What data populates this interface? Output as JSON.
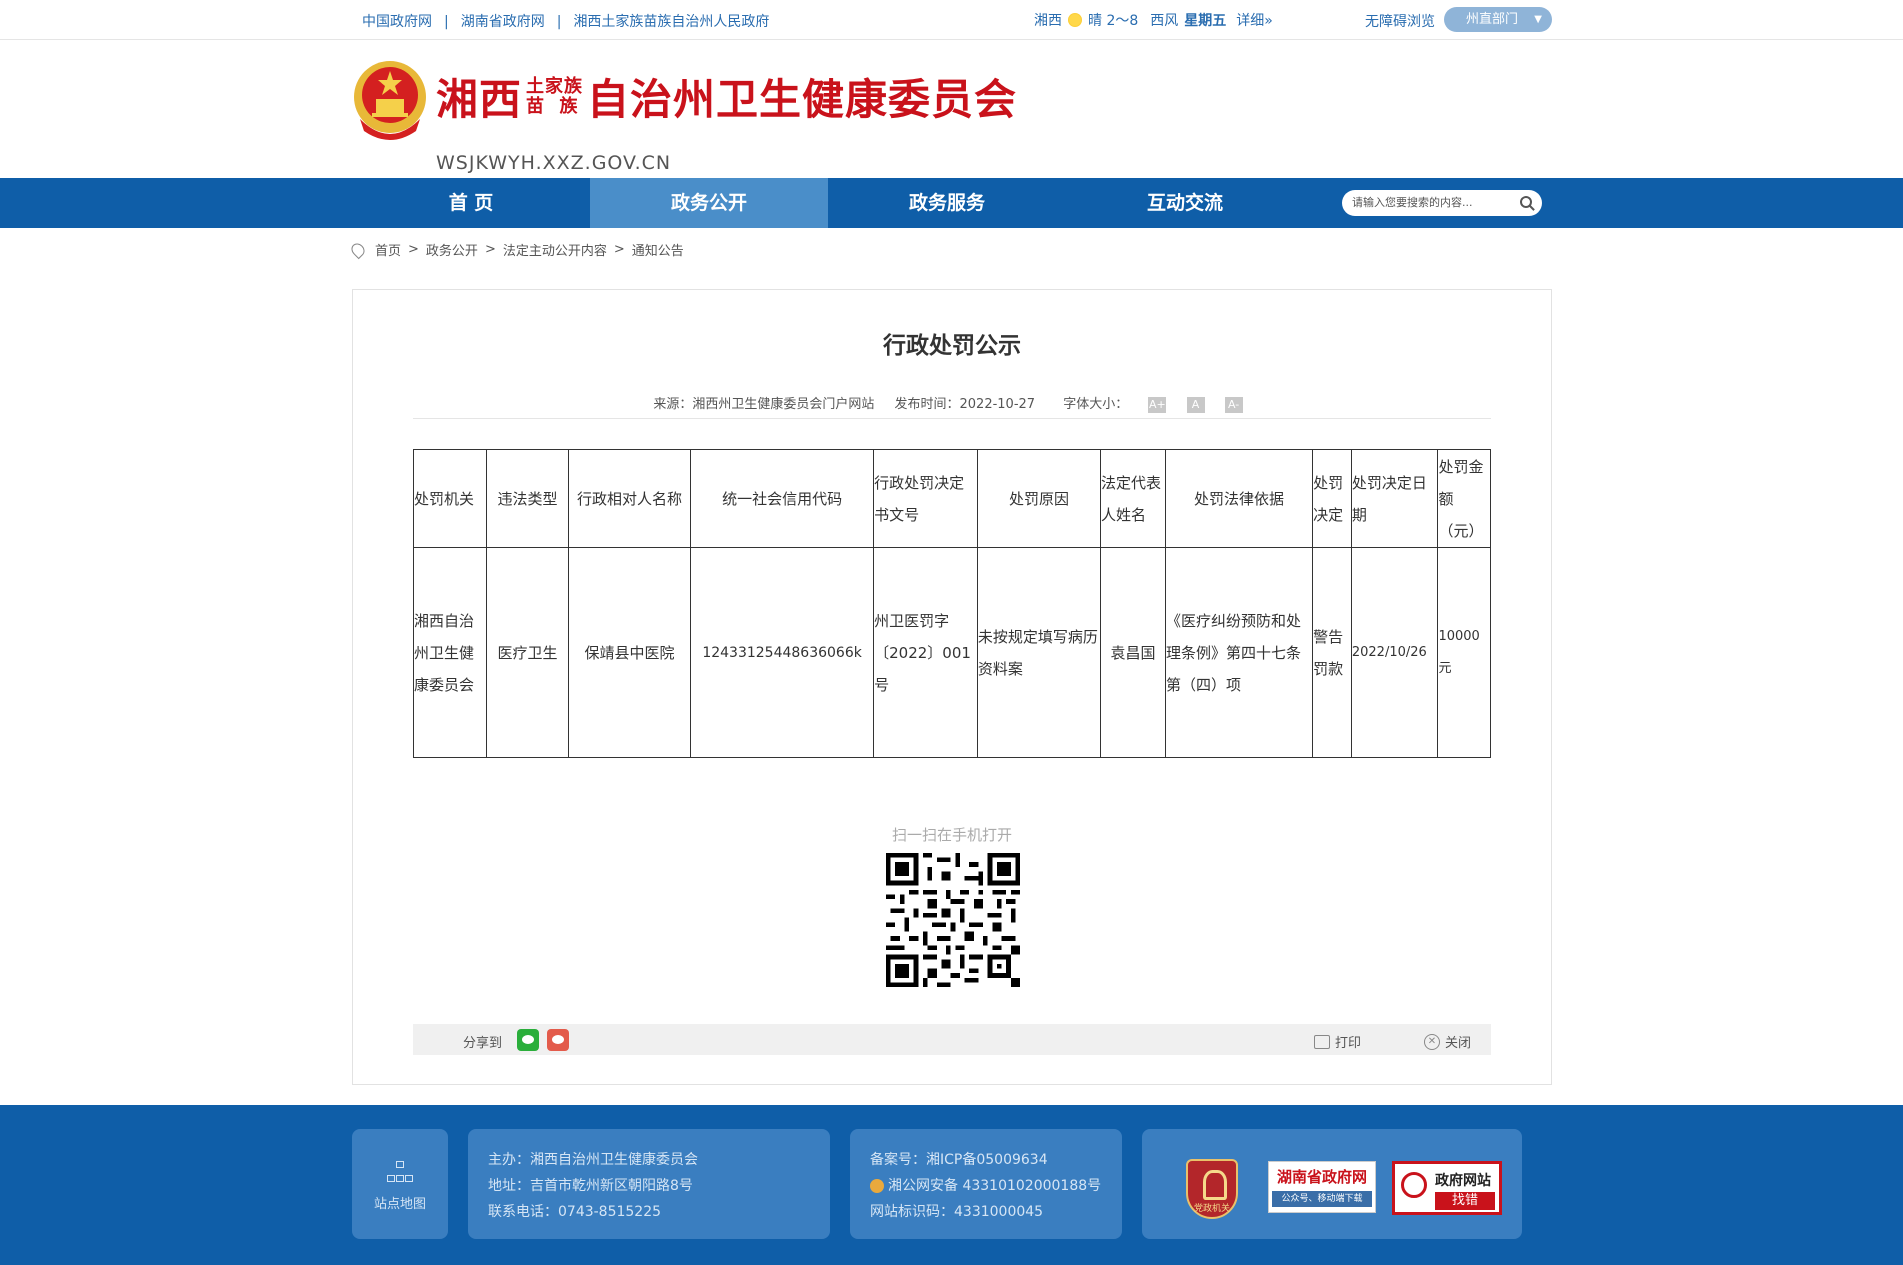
{
  "topbar": {
    "links": [
      "中国政府网",
      "湖南省政府网",
      "湘西土家族苗族自治州人民政府"
    ],
    "weather": {
      "city": "湘西",
      "condition": "晴 2～8",
      "wind": "西风",
      "weekday": "星期五",
      "detail": "详细»"
    },
    "accessible": "无障碍浏览",
    "dept_select": "州直部门"
  },
  "header": {
    "title_left": "湘西",
    "title_small_top": "土家族",
    "title_small_bottom": "苗  族",
    "title_right": "自治州卫生健康委员会",
    "url": "WSJKWYH.XXZ.GOV.CN"
  },
  "nav": {
    "items": [
      "首 页",
      "政务公开",
      "政务服务",
      "互动交流"
    ],
    "active_index": 1,
    "search_placeholder": "请输入您要搜索的内容..."
  },
  "breadcrumb": [
    "首页",
    "政务公开",
    "法定主动公开内容",
    "通知公告"
  ],
  "article": {
    "title": "行政处罚公示",
    "source": "来源：湘西州卫生健康委员会门户网站",
    "date": "发布时间：2022-10-27",
    "font_size_label": "字体大小：",
    "font_buttons": [
      "A+",
      "A",
      "A-"
    ],
    "table": {
      "headers": [
        "处罚机关",
        "违法类型",
        "行政相对人名称",
        "统一社会信用代码",
        "行政处罚决定书文号",
        "处罚原因",
        "法定代表人姓名",
        "处罚法律依据",
        "处罚决定",
        "处罚决定日期",
        "处罚金额（元）"
      ],
      "rows": [
        [
          "湘西自治州卫生健康委员会",
          "医疗卫生",
          "保靖县中医院",
          "12433125448636066k",
          "州卫医罚字〔2022〕001号",
          "未按规定填写病历资料案",
          "袁昌国",
          "《医疗纠纷预防和处理条例》第四十七条第（四）项",
          "警告罚款",
          "2022/10/26",
          "10000元"
        ]
      ]
    },
    "qr_label": "扫一扫在手机打开",
    "share_label": "分享到",
    "print_label": "打印",
    "close_label": "关闭"
  },
  "footer": {
    "sitemap": "站点地图",
    "sponsor": "主办：湘西自治州卫生健康委员会",
    "address": "地址：吉首市乾州新区朝阳路8号",
    "phone": "联系电话：0743-8515225",
    "icp": "备案号：湘ICP备05009634",
    "police": "湘公网安备 43310102000188号",
    "site_id": "网站标识码：4331000045",
    "badge_text": "党政机关",
    "hn_gov_title": "湖南省政府网",
    "hn_gov_sub": "公众号、移动端下载",
    "zhaocuo_title": "政府网站",
    "zhaocuo_sub": "找错"
  }
}
